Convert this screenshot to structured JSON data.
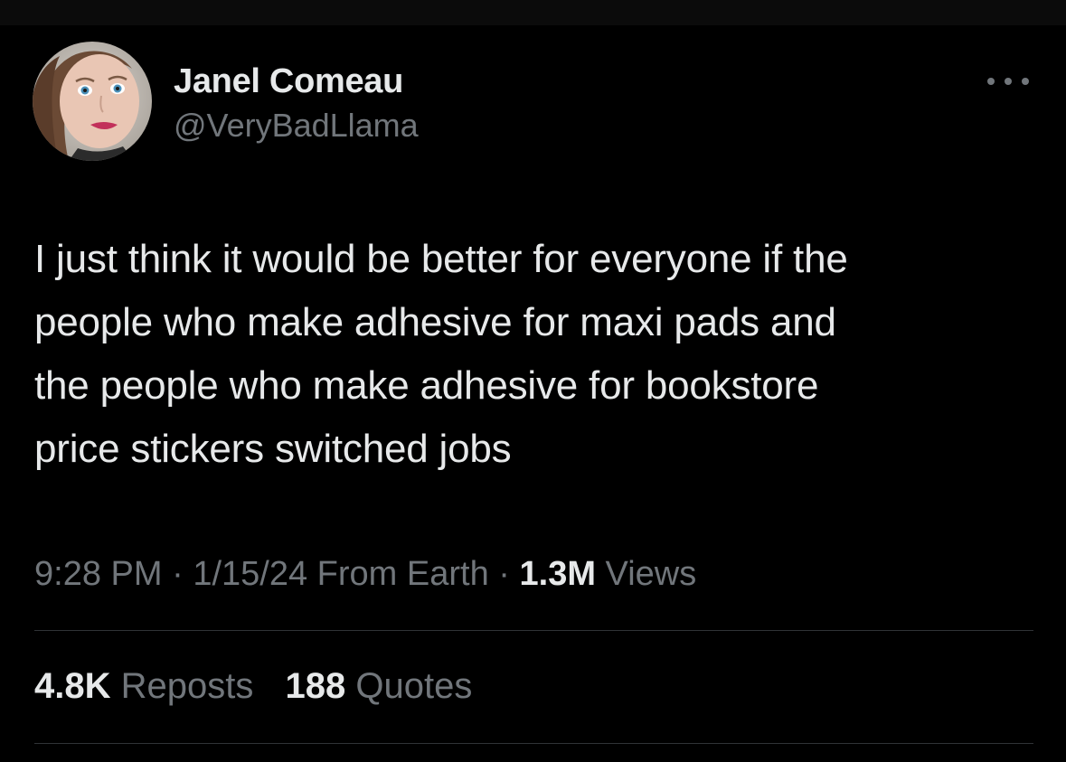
{
  "author": {
    "display_name": "Janel Comeau",
    "handle": "@VeryBadLlama",
    "avatar_icon": "profile-photo"
  },
  "more_icon": "ellipsis-icon",
  "tweet": {
    "text": "I just think it would be better for everyone if the\npeople who make adhesive for maxi pads and\nthe people who make adhesive for bookstore\nprice stickers switched jobs"
  },
  "meta": {
    "time": "9:28 PM",
    "separator": "·",
    "date": "1/15/24",
    "location": "From Earth",
    "views_count": "1.3M",
    "views_label": "Views"
  },
  "stats": {
    "reposts_count": "4.8K",
    "reposts_label": "Reposts",
    "quotes_count": "188",
    "quotes_label": "Quotes"
  },
  "colors": {
    "background": "#000000",
    "primary_text": "#e7e9ea",
    "secondary_text": "#71767b",
    "divider": "#2f3336"
  }
}
